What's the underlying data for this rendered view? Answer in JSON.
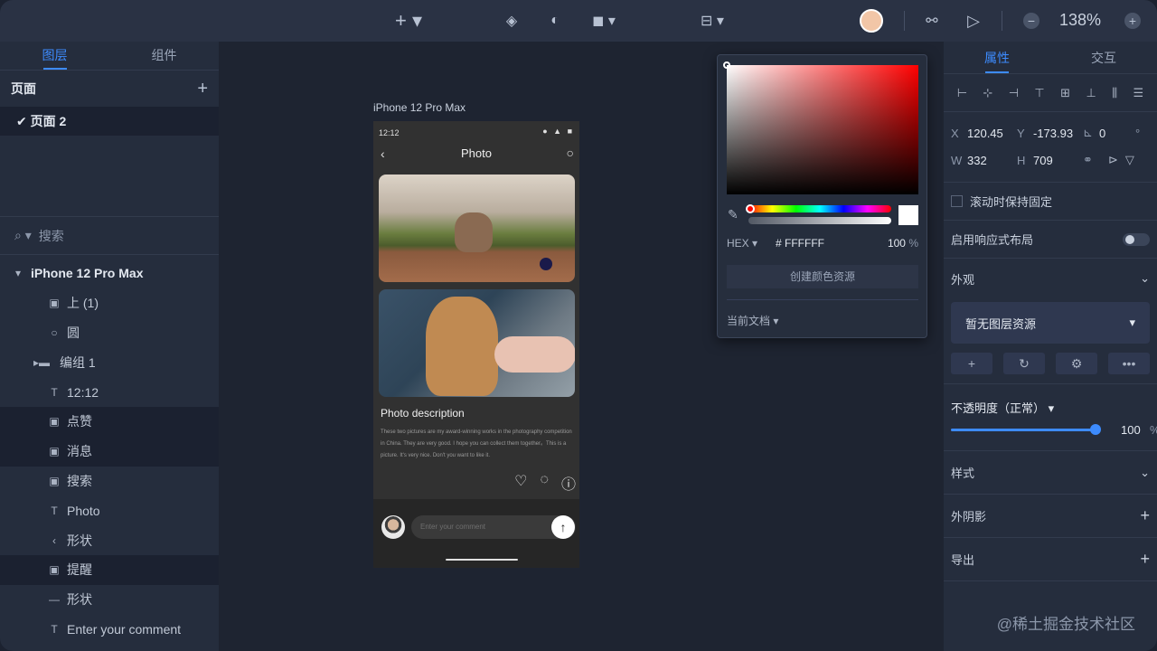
{
  "toolbar": {
    "zoom": "138%"
  },
  "left": {
    "tabs": [
      "图层",
      "组件"
    ],
    "pages_title": "页面",
    "add_icon": "+",
    "current_page": "✔ 页面 2",
    "search_placeholder": "搜索",
    "layers": [
      {
        "label": "iPhone 12 Pro Max",
        "icon": "▾",
        "type": "artboard"
      },
      {
        "label": "上 (1)",
        "icon": "▣",
        "type": "image"
      },
      {
        "label": "圆",
        "icon": "○",
        "type": "ellipse"
      },
      {
        "label": "编组 1",
        "icon": "▸▬",
        "type": "group"
      },
      {
        "label": "12:12",
        "icon": "T",
        "type": "text"
      },
      {
        "label": "点赞",
        "icon": "▣",
        "type": "image"
      },
      {
        "label": "消息",
        "icon": "▣",
        "type": "image"
      },
      {
        "label": "搜索",
        "icon": "▣",
        "type": "image"
      },
      {
        "label": "Photo",
        "icon": "T",
        "type": "text"
      },
      {
        "label": "形状",
        "icon": "‹",
        "type": "shape"
      },
      {
        "label": "提醒",
        "icon": "▣",
        "type": "image"
      },
      {
        "label": "形状",
        "icon": "—",
        "type": "shape"
      },
      {
        "label": "Enter your comment",
        "icon": "T",
        "type": "text"
      }
    ]
  },
  "canvas": {
    "frame_label": "iPhone 12 Pro Max",
    "phone": {
      "time": "12:12",
      "nav_title": "Photo",
      "desc_title": "Photo description",
      "desc_text": "These two pictures are my award-winning works in the photography competition in China. They are very good. I hope you can collect them together。This is a picture. It's very nice. Don't you want to like it.",
      "comment_placeholder": "Enter your comment"
    }
  },
  "picker": {
    "mode": "HEX",
    "hex_value": "# FFFFFF",
    "opacity": "100",
    "opacity_unit": "%",
    "create_button": "创建颜色资源",
    "scope": "当前文档"
  },
  "right": {
    "tabs": [
      "属性",
      "交互"
    ],
    "x_label": "X",
    "x": "120.45",
    "y_label": "Y",
    "y": "-173.93",
    "rot_value": "0",
    "rot_unit": "°",
    "w_label": "W",
    "w": "332",
    "h_label": "H",
    "h": "709",
    "fixed_scroll": "滚动时保持固定",
    "responsive": "启用响应式布局",
    "appearance": "外观",
    "no_style": "暂无图层资源",
    "opacity_label": "不透明度（正常）",
    "opacity_value": "100",
    "opacity_unit": "%",
    "opacity_level": 1.0,
    "style": "样式",
    "shadow": "外阴影",
    "export": "导出"
  },
  "watermark": "@稀土掘金技术社区"
}
